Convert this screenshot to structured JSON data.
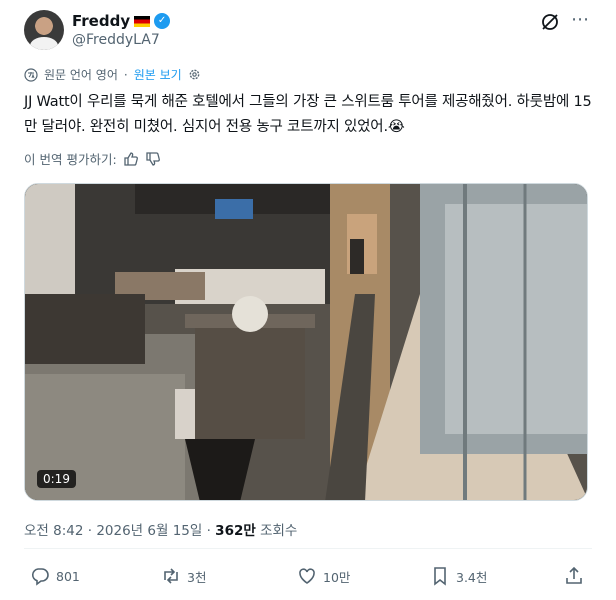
{
  "author": {
    "name": "Freddy",
    "handle": "@FreddyLA7",
    "flag_icon": "germany-flag-icon",
    "verified_icon": "verified-badge-icon"
  },
  "translation": {
    "source_label": "원문 언어 영어",
    "show_original_label": "원본 보기"
  },
  "tweet": {
    "text": "JJ Watt이 우리를 묵게 해준 호텔에서 그들의 가장 큰 스위트룸 투어를 제공해줬어. 하룻밤에 15만 달러야. 완전히 미쳤어. 심지어 전용 농구 코트까지 있었어.😭"
  },
  "rate_translation": {
    "label": "이 번역 평가하기:"
  },
  "video": {
    "duration": "0:19"
  },
  "meta": {
    "time_date": "오전 8:42 · 2026년 6월 15일 · ",
    "views_count": "362만",
    "views_label": " 조회수"
  },
  "actions": {
    "reply_count": "801",
    "retweet_count": "3천",
    "like_count": "10만",
    "bookmark_count": "3.4천"
  },
  "colors": {
    "accent": "#1d9bf0",
    "secondary_text": "#536471"
  }
}
